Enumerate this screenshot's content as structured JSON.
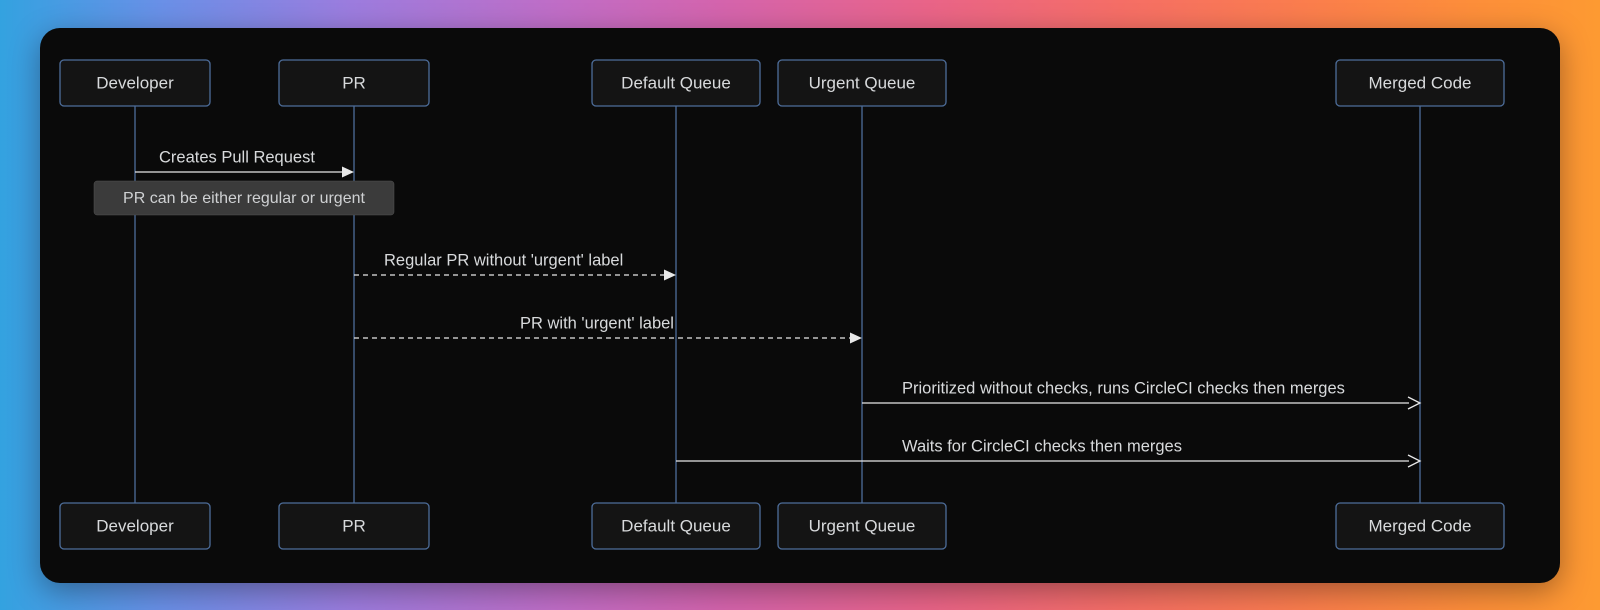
{
  "participants": {
    "developer": "Developer",
    "pr": "PR",
    "default_queue": "Default Queue",
    "urgent_queue": "Urgent Queue",
    "merged_code": "Merged Code"
  },
  "messages": {
    "create_pr": "Creates Pull Request",
    "note_pr_type": "PR can be either regular or urgent",
    "regular_pr": "Regular PR without 'urgent' label",
    "urgent_pr": "PR with 'urgent' label",
    "prioritized": "Prioritized without checks, runs CircleCI checks then merges",
    "waits": "Waits for CircleCI checks then merges"
  },
  "layout": {
    "x": {
      "developer": 95,
      "pr": 314,
      "default_queue": 636,
      "urgent_queue": 822,
      "merged_code": 1380
    },
    "boxW": {
      "developer": 150,
      "pr": 150,
      "default_queue": 168,
      "urgent_queue": 168,
      "merged_code": 168
    },
    "topBoxY": 32,
    "boxH": 46,
    "bottomBoxY": 475,
    "rows": {
      "create_pr": 130,
      "note": 170,
      "regular_pr": 245,
      "urgent_pr": 310,
      "prioritized": 375,
      "waits": 433
    },
    "noteW": 300,
    "noteH": 34
  },
  "colors": {
    "actor_stroke": "#4d6d9a",
    "actor_fill": "#141414",
    "text": "#d8dadc",
    "line": "#e8e8e8",
    "note_fill": "#3b3b3b",
    "panel_bg": "#0a0a0a"
  }
}
